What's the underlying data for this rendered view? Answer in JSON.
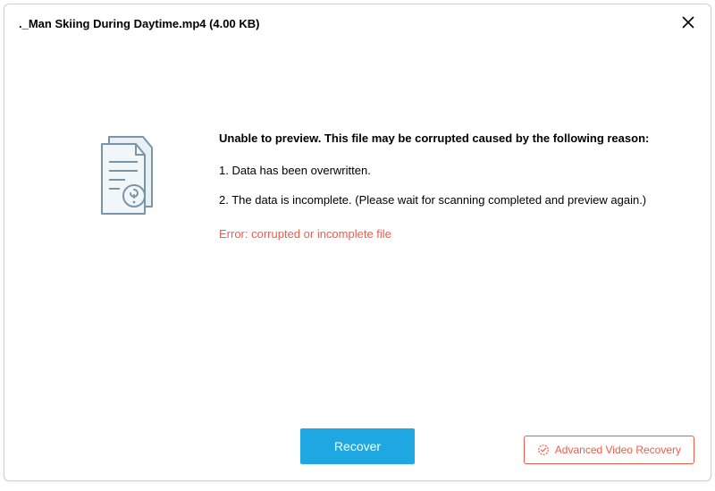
{
  "header": {
    "title": "._Man Skiing During Daytime.mp4 (4.00  KB)"
  },
  "message": {
    "heading": "Unable to preview. This file may be corrupted caused by the following reason:",
    "reason1": "1. Data has been overwritten.",
    "reason2": "2. The data is incomplete. (Please wait for scanning completed and preview again.)",
    "error": "Error: corrupted or incomplete file"
  },
  "actions": {
    "recover_label": "Recover",
    "advanced_label": "Advanced Video Recovery"
  }
}
